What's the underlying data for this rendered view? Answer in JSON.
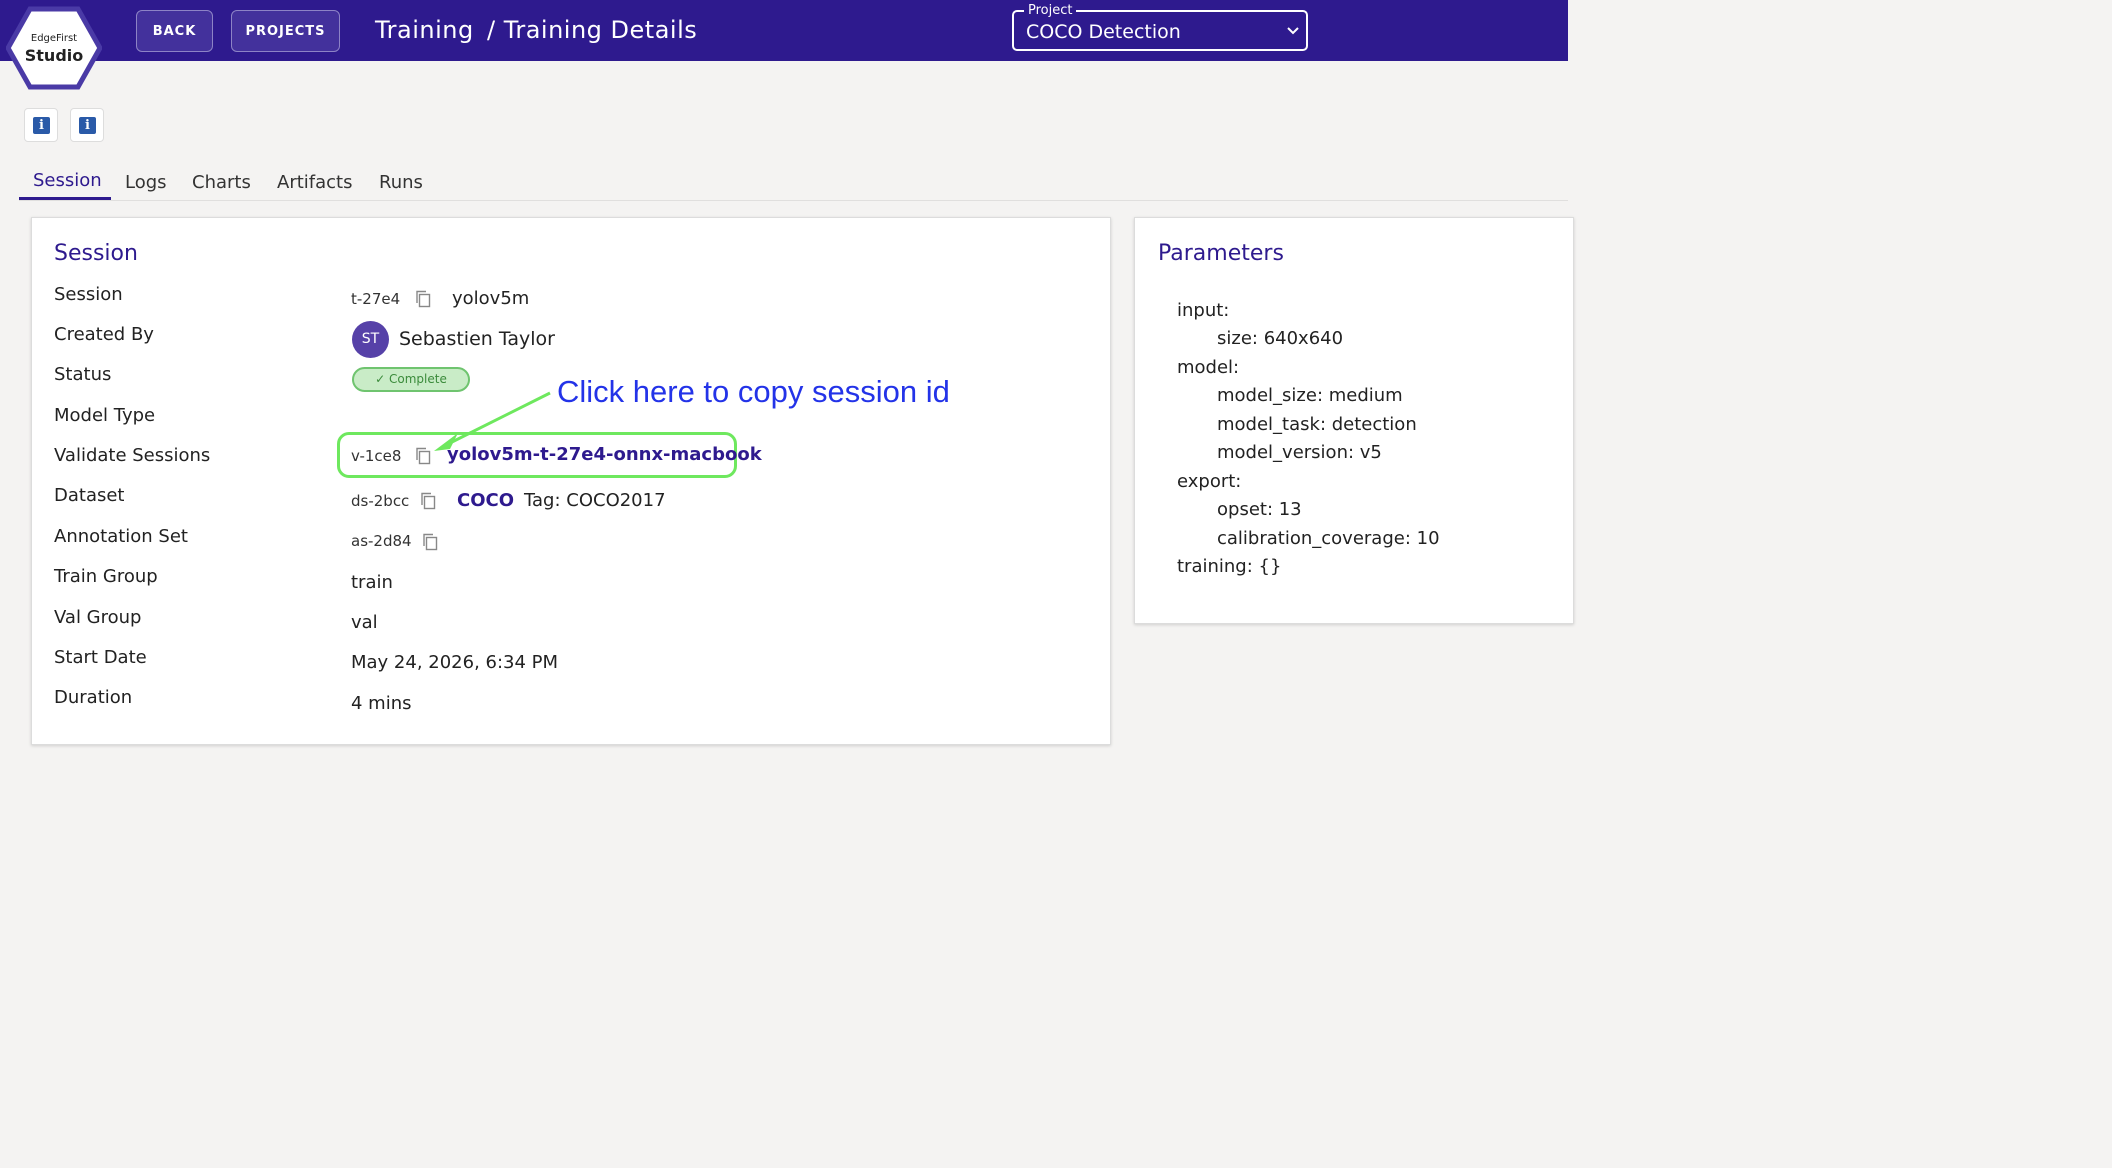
{
  "logo": {
    "line1": "EdgeFirst",
    "line2": "Studio"
  },
  "nav": {
    "back_label": "BACK",
    "projects_label": "PROJECTS"
  },
  "breadcrumb": {
    "root": "Training",
    "current": "/ Training Details"
  },
  "project_select": {
    "label": "Project",
    "value": "COCO Detection"
  },
  "tabs": [
    "Session",
    "Logs",
    "Charts",
    "Artifacts",
    "Runs"
  ],
  "active_tab": "Session",
  "session_card": {
    "title": "Session",
    "labels": {
      "session": "Session",
      "created_by": "Created By",
      "status": "Status",
      "model_type": "Model Type",
      "validate_sessions": "Validate Sessions",
      "dataset": "Dataset",
      "annotation_set": "Annotation Set",
      "train_group": "Train Group",
      "val_group": "Val Group",
      "start_date": "Start Date",
      "duration": "Duration"
    },
    "session_id": "t-27e4",
    "session_name": "yolov5m",
    "creator_initials": "ST",
    "creator_name": "Sebastien Taylor",
    "status": "✓ Complete",
    "validate_id": "v-1ce8",
    "validate_name": "yolov5m-t-27e4-onnx-macbook",
    "dataset_id": "ds-2bcc",
    "dataset_name": "COCO",
    "dataset_tag": "Tag: COCO2017",
    "annotation_set_id": "as-2d84",
    "train_group": "train",
    "val_group": "val",
    "start_date": "May 24, 2026, 6:34 PM",
    "duration": "4 mins"
  },
  "annotation": {
    "text": "Click here to copy session id"
  },
  "parameters_card": {
    "title": "Parameters",
    "lines": [
      "input:",
      "size: 640x640",
      "model:",
      "model_size: medium",
      "model_task: detection",
      "model_version: v5",
      "export:",
      "opset: 13",
      "calibration_coverage: 10",
      "training: {}"
    ]
  },
  "colors": {
    "brand": "#2e1a8e",
    "highlight": "#6ee85e",
    "annotation": "#2333e8",
    "status": "#6fc46f"
  }
}
